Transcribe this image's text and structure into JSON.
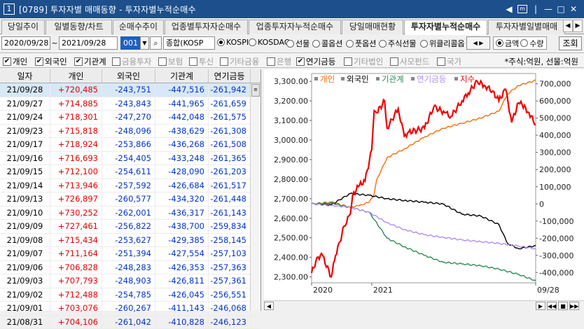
{
  "window": {
    "screen_no": "1",
    "title": "[0789] 투자자별 매매동향 - 투자자별누적순매수"
  },
  "tabs": [
    "당일추이",
    "일별동향/차트",
    "순매수추이",
    "업종별투자자순매수",
    "업종투자자누적순매수",
    "당일매매현황",
    "투자자별누적순매수",
    "투자자별일별매매"
  ],
  "active_tab": 6,
  "controls": {
    "date_from": "2020/09/28",
    "tilde": "~",
    "date_to": "2021/09/28",
    "market_code": "001",
    "market_name": "종합(KOSP",
    "markets": [
      {
        "label": "KOSPI",
        "checked": true
      },
      {
        "label": "KOSDAQ",
        "checked": false
      },
      {
        "label": "선물",
        "checked": false
      },
      {
        "label": "콜옵션",
        "checked": false
      },
      {
        "label": "풋옵션",
        "checked": false
      },
      {
        "label": "주식선물",
        "checked": false
      },
      {
        "label": "위클리콜옵",
        "checked": false
      }
    ],
    "modes": [
      {
        "label": "금액",
        "checked": true
      },
      {
        "label": "수량",
        "checked": false
      }
    ],
    "query_button": "조회"
  },
  "filters": [
    {
      "label": "개인",
      "checked": true
    },
    {
      "label": "외국인",
      "checked": true
    },
    {
      "label": "기관계",
      "checked": true
    },
    {
      "label": "금융투자",
      "checked": false
    },
    {
      "label": "보험",
      "checked": false
    },
    {
      "label": "투신",
      "checked": false
    },
    {
      "label": "기타금융",
      "checked": false
    },
    {
      "label": "은행",
      "checked": false
    },
    {
      "label": "연기금등",
      "checked": true
    },
    {
      "label": "기타법인",
      "checked": false
    },
    {
      "label": "사모펀드",
      "checked": false
    },
    {
      "label": "국가",
      "checked": false
    }
  ],
  "unit_note": "*주식:억원, 선물:억원",
  "table": {
    "headers": [
      "일자",
      "개인",
      "외국인",
      "기관계",
      "연기금등"
    ],
    "rows": [
      [
        "21/09/28",
        "+720,485",
        "-243,751",
        "-447,516",
        "-261,942"
      ],
      [
        "21/09/27",
        "+714,885",
        "-243,843",
        "-441,965",
        "-261,659"
      ],
      [
        "21/09/24",
        "+718,301",
        "-247,270",
        "-442,048",
        "-261,575"
      ],
      [
        "21/09/23",
        "+715,818",
        "-248,096",
        "-438,629",
        "-261,308"
      ],
      [
        "21/09/17",
        "+718,924",
        "-253,866",
        "-436,268",
        "-261,508"
      ],
      [
        "21/09/16",
        "+716,693",
        "-254,405",
        "-433,248",
        "-261,365"
      ],
      [
        "21/09/15",
        "+712,100",
        "-254,611",
        "-428,090",
        "-261,203"
      ],
      [
        "21/09/14",
        "+713,946",
        "-257,592",
        "-426,684",
        "-261,517"
      ],
      [
        "21/09/13",
        "+726,897",
        "-260,577",
        "-434,320",
        "-261,448"
      ],
      [
        "21/09/10",
        "+730,252",
        "-262,001",
        "-436,317",
        "-261,143"
      ],
      [
        "21/09/09",
        "+727,461",
        "-256,822",
        "-438,700",
        "-259,834"
      ],
      [
        "21/09/08",
        "+715,434",
        "-253,627",
        "-429,385",
        "-258,145"
      ],
      [
        "21/09/07",
        "+711,164",
        "-251,394",
        "-427,554",
        "-257,103"
      ],
      [
        "21/09/06",
        "+706,828",
        "-248,283",
        "-426,353",
        "-257,363"
      ],
      [
        "21/09/03",
        "+707,793",
        "-248,903",
        "-426,811",
        "-257,361"
      ],
      [
        "21/09/02",
        "+712,488",
        "-254,785",
        "-426,045",
        "-256,551"
      ],
      [
        "21/09/01",
        "+703,076",
        "-260,267",
        "-411,143",
        "-246,068"
      ],
      [
        "21/08/31",
        "+704,106",
        "-261,042",
        "-410,828",
        "-246,123"
      ]
    ]
  },
  "chart_data": {
    "type": "line",
    "legend": [
      {
        "name": "개인",
        "color": "#ff6a00"
      },
      {
        "name": "외국인",
        "color": "#000000"
      },
      {
        "name": "기관계",
        "color": "#2e8b57"
      },
      {
        "name": "연기금등",
        "color": "#b38cf2"
      },
      {
        "name": "지수",
        "color": "#ee0000"
      }
    ],
    "left_axis": {
      "ticks": [
        3300,
        3200,
        3100,
        3000,
        2900,
        2800,
        2700,
        2600,
        2500,
        2400,
        2300
      ],
      "labels": [
        "3,300.00",
        "3,200.00",
        "3,100.00",
        "3,000.00",
        "2,900.00",
        "2,800.00",
        "2,700.00",
        "2,600.00",
        "2,500.00",
        "2,400.00",
        "2,300.00"
      ],
      "ylim": [
        2270,
        3340
      ]
    },
    "right_axis": {
      "ticks": [
        700000,
        600000,
        500000,
        400000,
        300000,
        200000,
        100000,
        0,
        -100000,
        -200000,
        -300000,
        -400000
      ],
      "labels": [
        "700,000",
        "600,000",
        "500,000",
        "400,000",
        "300,000",
        "200,000",
        "100,000",
        "0",
        "-100,000",
        "-200,000",
        "-300,000",
        "-400,000"
      ],
      "ylim": [
        -460000,
        760000
      ]
    },
    "x_labels": [
      "2020",
      "2021",
      "09/28"
    ],
    "x_label_dates": [
      "2020-09-28",
      "2021-01-04",
      "2021-09-28"
    ],
    "x_start": "2020-09-28",
    "x_end": "2021-09-28",
    "series": [
      {
        "name": "개인",
        "axis": "right",
        "x": [
          "2020-09-28",
          "2020-10-30",
          "2020-11-30",
          "2020-12-15",
          "2020-12-31",
          "2021-01-08",
          "2021-01-12",
          "2021-01-29",
          "2021-02-26",
          "2021-03-31",
          "2021-04-30",
          "2021-05-31",
          "2021-06-30",
          "2021-07-30",
          "2021-08-13",
          "2021-08-31",
          "2021-09-28"
        ],
        "y": [
          0,
          10000,
          -20000,
          -10000,
          10000,
          60000,
          140000,
          270000,
          320000,
          390000,
          440000,
          470000,
          500000,
          540000,
          640000,
          690000,
          720000
        ]
      },
      {
        "name": "외국인",
        "axis": "right",
        "x": [
          "2020-09-28",
          "2020-10-30",
          "2020-11-30",
          "2020-12-31",
          "2021-01-29",
          "2021-02-26",
          "2021-03-31",
          "2021-04-30",
          "2021-05-31",
          "2021-06-30",
          "2021-07-30",
          "2021-08-13",
          "2021-08-31",
          "2021-09-28"
        ],
        "y": [
          0,
          -5000,
          60000,
          50000,
          30000,
          20000,
          10000,
          0,
          -60000,
          -70000,
          -120000,
          -230000,
          -261000,
          -244000
        ]
      },
      {
        "name": "기관계",
        "axis": "right",
        "x": [
          "2020-09-28",
          "2020-10-30",
          "2020-11-30",
          "2020-12-31",
          "2021-01-29",
          "2021-02-26",
          "2021-03-31",
          "2021-04-30",
          "2021-05-31",
          "2021-06-30",
          "2021-07-30",
          "2021-08-31",
          "2021-09-28"
        ],
        "y": [
          0,
          5000,
          -20000,
          -50000,
          -200000,
          -250000,
          -300000,
          -340000,
          -350000,
          -360000,
          -380000,
          -411000,
          -448000
        ]
      },
      {
        "name": "연기금등",
        "axis": "right",
        "x": [
          "2020-09-28",
          "2020-10-30",
          "2020-11-30",
          "2020-12-31",
          "2021-01-29",
          "2021-02-26",
          "2021-03-31",
          "2021-04-30",
          "2021-05-31",
          "2021-06-30",
          "2021-07-30",
          "2021-08-31",
          "2021-09-28"
        ],
        "y": [
          0,
          -10000,
          -20000,
          -50000,
          -110000,
          -150000,
          -180000,
          -195000,
          -210000,
          -220000,
          -230000,
          -246000,
          -262000
        ]
      },
      {
        "name": "지수",
        "axis": "left",
        "x": [
          "2020-09-28",
          "2020-10-05",
          "2020-10-14",
          "2020-10-30",
          "2020-11-06",
          "2020-11-13",
          "2020-11-20",
          "2020-11-30",
          "2020-12-04",
          "2020-12-15",
          "2020-12-24",
          "2021-01-04",
          "2021-01-08",
          "2021-01-12",
          "2021-01-25",
          "2021-01-29",
          "2021-02-16",
          "2021-02-26",
          "2021-03-05",
          "2021-03-31",
          "2021-04-15",
          "2021-05-03",
          "2021-05-13",
          "2021-05-31",
          "2021-06-10",
          "2021-06-25",
          "2021-07-06",
          "2021-07-20",
          "2021-07-30",
          "2021-08-10",
          "2021-08-20",
          "2021-08-31",
          "2021-09-06",
          "2021-09-17",
          "2021-09-28"
        ],
        "y": [
          2320,
          2380,
          2420,
          2300,
          2410,
          2480,
          2560,
          2620,
          2720,
          2770,
          2790,
          2950,
          3150,
          3140,
          3200,
          3060,
          3160,
          3020,
          3040,
          3060,
          3170,
          3140,
          3120,
          3200,
          3240,
          3300,
          3280,
          3250,
          3200,
          3260,
          3090,
          3190,
          3180,
          3140,
          3080
        ]
      }
    ]
  }
}
